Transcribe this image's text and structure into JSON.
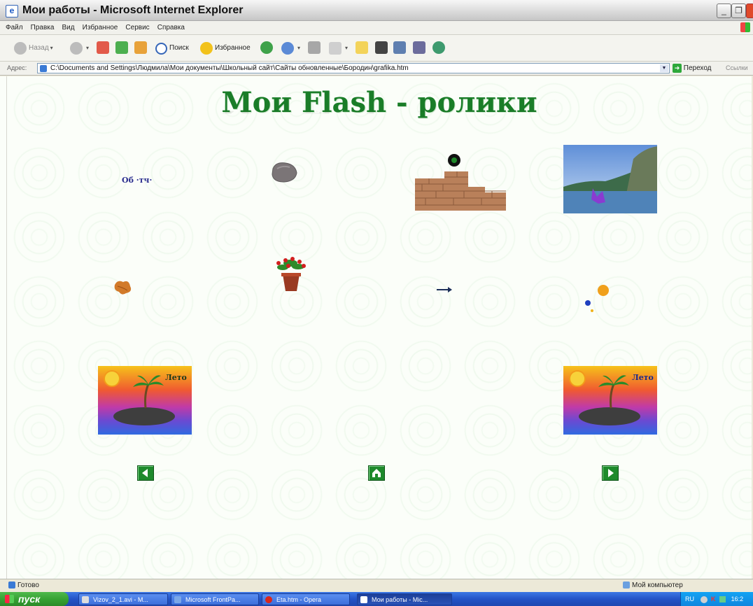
{
  "window": {
    "title": "Мои работы - Microsoft Internet Explorer",
    "icon": "ie-page-icon",
    "controls": [
      "minimize-icon",
      "maximize-icon",
      "close-icon"
    ]
  },
  "menu": {
    "items": [
      "Файл",
      "Правка",
      "Вид",
      "Избранное",
      "Сервис",
      "Справка"
    ]
  },
  "toolbar": {
    "back_label": "Назад",
    "search_label": "Поиск",
    "favorites_label": "Избранное"
  },
  "address": {
    "label": "Адрес:",
    "value": "C:\\Documents and Settings\\Людмила\\Мои документы\\Школьный сайт\\Сайты обновленные\\Бородин\\grafika.htm",
    "go_label": "Переход",
    "links_label": "Ссылки"
  },
  "page": {
    "heading": "Мои Flash - ролики",
    "thumbnails": [
      {
        "name": "text-animation-thumb",
        "text": "Об  ·тч·"
      },
      {
        "name": "rock-thumb"
      },
      {
        "name": "brick-wall-ball-thumb"
      },
      {
        "name": "sea-landscape-thumb"
      },
      {
        "name": "leaf-thumb"
      },
      {
        "name": "flower-pot-thumb"
      },
      {
        "name": "arrow-thumb"
      },
      {
        "name": "planets-thumb"
      },
      {
        "name": "summer-island-thumb-left",
        "text": "Лето"
      },
      {
        "name": "summer-island-thumb-right",
        "text": "Лето"
      }
    ],
    "nav": {
      "prev": "prev-arrow-icon",
      "home": "home-icon",
      "next": "next-arrow-icon"
    }
  },
  "status": {
    "left": "Готово",
    "zone": "Мой компьютер"
  },
  "taskbar": {
    "start_label": "пуск",
    "tasks": [
      "Vizov_2_1.avi - M...",
      "Microsoft FrontPa...",
      "Eta.htm - Opera",
      "Мои работы - Mic..."
    ],
    "tray": {
      "lang": "RU",
      "time": "16:2"
    }
  }
}
